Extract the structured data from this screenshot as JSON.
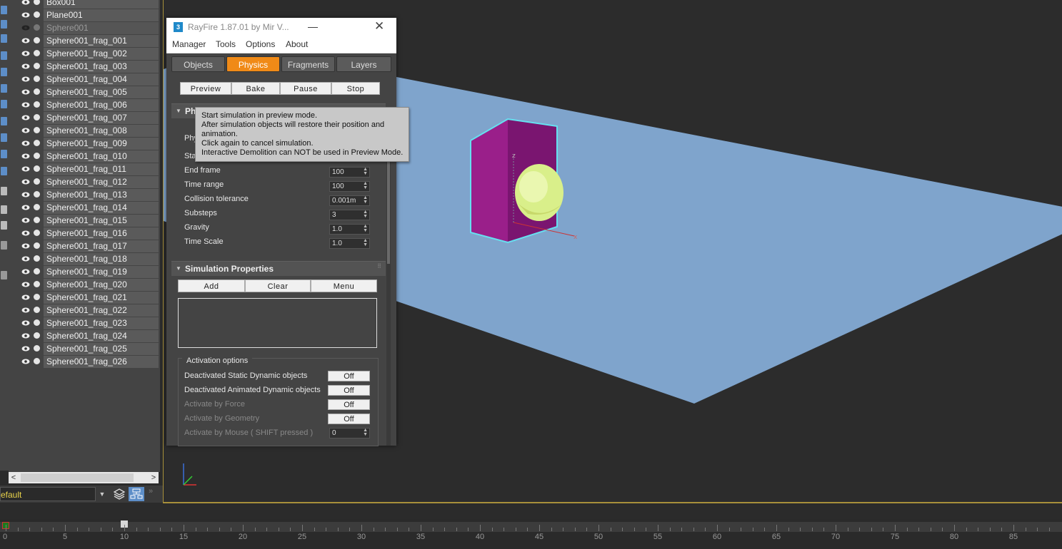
{
  "explorer": {
    "items": [
      {
        "name": "Box001",
        "hidden": false
      },
      {
        "name": "Plane001",
        "hidden": false
      },
      {
        "name": "Sphere001",
        "hidden": true
      },
      {
        "name": "Sphere001_frag_001",
        "hidden": false
      },
      {
        "name": "Sphere001_frag_002",
        "hidden": false
      },
      {
        "name": "Sphere001_frag_003",
        "hidden": false
      },
      {
        "name": "Sphere001_frag_004",
        "hidden": false
      },
      {
        "name": "Sphere001_frag_005",
        "hidden": false
      },
      {
        "name": "Sphere001_frag_006",
        "hidden": false
      },
      {
        "name": "Sphere001_frag_007",
        "hidden": false
      },
      {
        "name": "Sphere001_frag_008",
        "hidden": false
      },
      {
        "name": "Sphere001_frag_009",
        "hidden": false
      },
      {
        "name": "Sphere001_frag_010",
        "hidden": false
      },
      {
        "name": "Sphere001_frag_011",
        "hidden": false
      },
      {
        "name": "Sphere001_frag_012",
        "hidden": false
      },
      {
        "name": "Sphere001_frag_013",
        "hidden": false
      },
      {
        "name": "Sphere001_frag_014",
        "hidden": false
      },
      {
        "name": "Sphere001_frag_015",
        "hidden": false
      },
      {
        "name": "Sphere001_frag_016",
        "hidden": false
      },
      {
        "name": "Sphere001_frag_017",
        "hidden": false
      },
      {
        "name": "Sphere001_frag_018",
        "hidden": false
      },
      {
        "name": "Sphere001_frag_019",
        "hidden": false
      },
      {
        "name": "Sphere001_frag_020",
        "hidden": false
      },
      {
        "name": "Sphere001_frag_021",
        "hidden": false
      },
      {
        "name": "Sphere001_frag_022",
        "hidden": false
      },
      {
        "name": "Sphere001_frag_023",
        "hidden": false
      },
      {
        "name": "Sphere001_frag_024",
        "hidden": false
      },
      {
        "name": "Sphere001_frag_025",
        "hidden": false
      },
      {
        "name": "Sphere001_frag_026",
        "hidden": false
      }
    ]
  },
  "layer_field": "efault",
  "rayfire": {
    "title": "RayFire 1.87.01   by Mir V...",
    "app_icon": "3",
    "menu": [
      "Manager",
      "Tools",
      "Options",
      "About"
    ],
    "tabs": [
      {
        "label": "Objects",
        "active": false
      },
      {
        "label": "Physics",
        "active": true
      },
      {
        "label": "Fragments",
        "active": false
      },
      {
        "label": "Layers",
        "active": false
      }
    ],
    "sim_buttons": [
      "Preview",
      "Bake",
      "Pause",
      "Stop"
    ],
    "physics_rollout": {
      "title": "Ph",
      "partial_labels": [
        "Phy",
        "Sta"
      ],
      "properties": [
        {
          "label": "End frame",
          "value": "100"
        },
        {
          "label": "Time range",
          "value": "100"
        },
        {
          "label": "Collision tolerance",
          "value": "0.001m"
        },
        {
          "label": "Substeps",
          "value": "3"
        },
        {
          "label": "Gravity",
          "value": "1.0"
        },
        {
          "label": "Time Scale",
          "value": "1.0"
        }
      ]
    },
    "sim_props": {
      "title": "Simulation Properties",
      "buttons": [
        "Add",
        "Clear",
        "Menu"
      ]
    },
    "activation": {
      "title": "Activation options",
      "options": [
        {
          "label": "Deactivated Static Dynamic objects",
          "value": "Off",
          "enabled": true,
          "kind": "toggle"
        },
        {
          "label": "Deactivated Animated Dynamic objects",
          "value": "Off",
          "enabled": true,
          "kind": "toggle"
        },
        {
          "label": "Activate by Force",
          "value": "Off",
          "enabled": false,
          "kind": "toggle"
        },
        {
          "label": "Activate by Geometry",
          "value": "Off",
          "enabled": false,
          "kind": "toggle"
        },
        {
          "label": "Activate by Mouse ( SHIFT pressed )",
          "value": "0",
          "enabled": false,
          "kind": "spinner"
        }
      ]
    },
    "tooltip": [
      "Start simulation in preview mode.",
      "After simulation objects will restore their position and",
      "animation.",
      "Click again to cancel simulation.",
      "Interactive Demolition can NOT be used in Preview Mode."
    ]
  },
  "timeline": {
    "start": "0",
    "current_frame": 10,
    "labels": [
      "5",
      "10",
      "15",
      "20",
      "25",
      "30",
      "35",
      "40",
      "45",
      "50",
      "55",
      "60",
      "65",
      "70",
      "75",
      "80",
      "85"
    ]
  },
  "viewport": {
    "gizmo_labels": [
      "z",
      "x"
    ],
    "colors": {
      "plane": "#7fa4cc",
      "box": "#9a1f8a",
      "selection": "#66e0f0",
      "sphere": "#d9ef8a"
    }
  }
}
